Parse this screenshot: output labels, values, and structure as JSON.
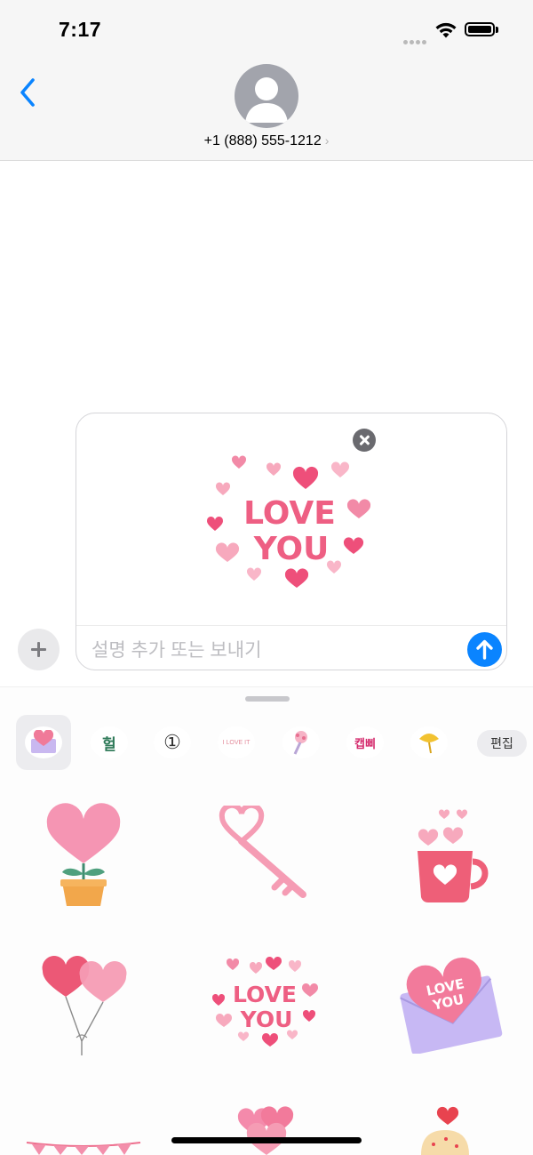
{
  "status_bar": {
    "time": "7:17"
  },
  "header": {
    "contact": "+1 (888) 555-1212",
    "contact_chevron": "›"
  },
  "compose": {
    "placeholder": "설명 추가 또는 보내기",
    "preview_sticker": {
      "line1": "LOVE",
      "line2": "YOU"
    }
  },
  "drawer": {
    "tabs": [
      {
        "icon": "love-letter-sticker-pack-icon",
        "label": ""
      },
      {
        "icon": "korean-text-sticker-pack-icon",
        "label": "헐"
      },
      {
        "icon": "circled-number-pack-icon",
        "label": "①"
      },
      {
        "icon": "i-love-it-sticker-pack-icon",
        "label": "I LOVE IT"
      },
      {
        "icon": "flower-bouquet-pack-icon",
        "label": ""
      },
      {
        "icon": "korean-text-sticker-pack-icon",
        "label": "캡삐"
      },
      {
        "icon": "ginkgo-leaf-pack-icon",
        "label": ""
      }
    ],
    "edit_label": "편집",
    "stickers": [
      {
        "name": "heart-plant-sticker"
      },
      {
        "name": "heart-key-sticker"
      },
      {
        "name": "heart-mug-sticker"
      },
      {
        "name": "heart-balloons-sticker"
      },
      {
        "name": "love-you-sticker",
        "line1": "LOVE",
        "line2": "YOU"
      },
      {
        "name": "love-you-envelope-sticker",
        "line1": "LOVE",
        "line2": "YOU"
      }
    ]
  },
  "colors": {
    "accent": "#0a84ff",
    "sticker_pink": "#ee6f8e"
  }
}
